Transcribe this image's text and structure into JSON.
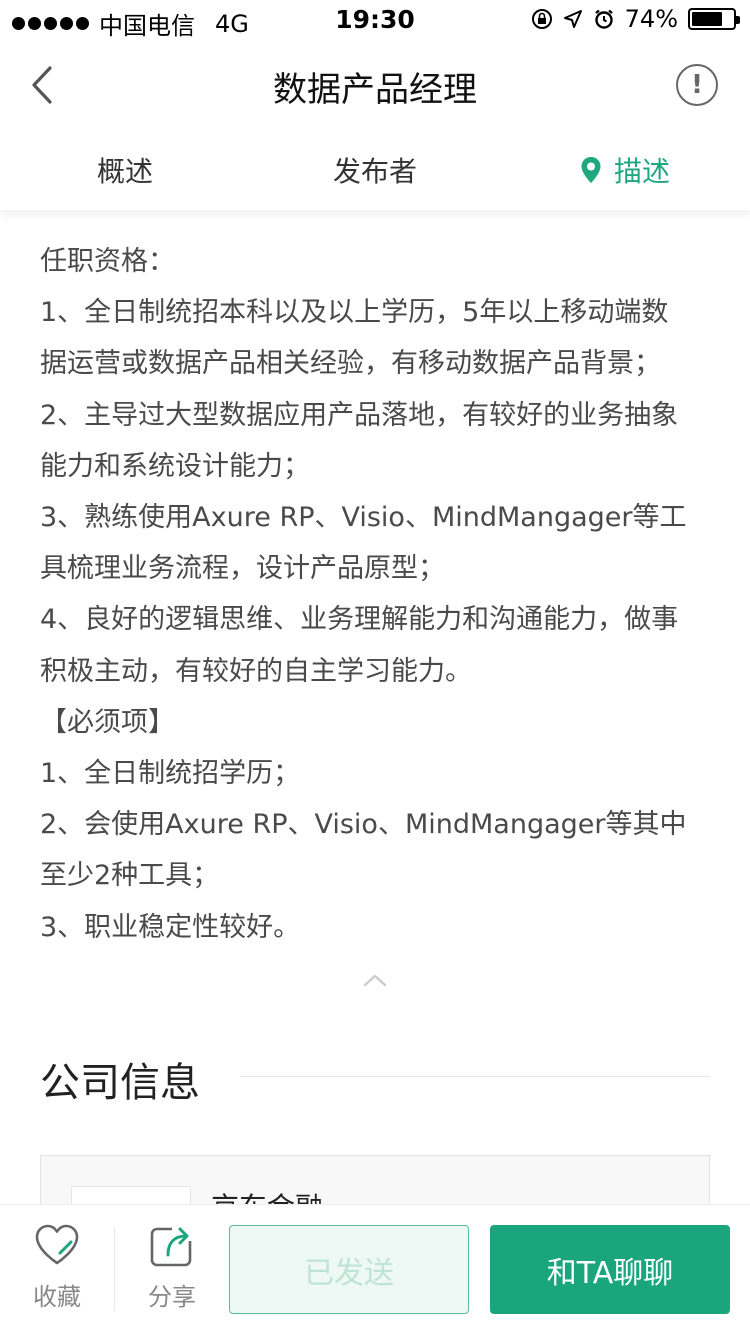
{
  "status_bar": {
    "carrier": "中国电信",
    "network": "4G",
    "time": "19:30",
    "battery": "74%",
    "battery_level": 0.74,
    "icons": [
      "lock-rotation-icon",
      "location-arrow-icon",
      "alarm-icon"
    ]
  },
  "nav": {
    "title": "数据产品经理",
    "back_icon": "chevron-left-icon",
    "alert_icon": "exclamation-circle-icon",
    "alert_glyph": "!"
  },
  "tabs": [
    {
      "label": "概述",
      "active": false
    },
    {
      "label": "发布者",
      "active": false
    },
    {
      "label": "描述",
      "active": true,
      "icon": "location-pin-icon"
    }
  ],
  "description": {
    "lines": [
      "任职资格：",
      "1、全日制统招本科以及以上学历，5年以上移动端数",
      "据运营或数据产品相关经验，有移动数据产品背景；",
      "2、主导过大型数据应用产品落地，有较好的业务抽象",
      "能力和系统设计能力；",
      "3、熟练使用Axure RP、Visio、MindMangager等工",
      "具梳理业务流程，设计产品原型；",
      "4、良好的逻辑思维、业务理解能力和沟通能力，做事",
      "积极主动，有较好的自主学习能力。",
      "【必须项】",
      "1、全日制统招学历；",
      "2、会使用Axure RP、Visio、MindMangager等其中",
      "至少2种工具；",
      "3、职业稳定性较好。"
    ]
  },
  "company": {
    "section_title": "公司信息",
    "name": "京东金融"
  },
  "bottom_bar": {
    "favorite_label": "收藏",
    "share_label": "分享",
    "sent_label": "已发送",
    "chat_label": "和TA聊聊"
  },
  "colors": {
    "accent": "#1aa57d",
    "sent_border": "#59bd9a",
    "sent_text": "#bfe4d6"
  }
}
